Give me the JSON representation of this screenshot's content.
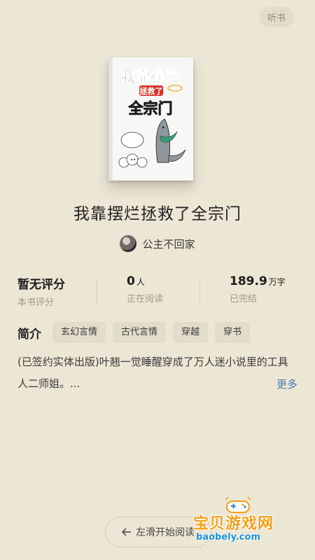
{
  "header": {
    "listen_label": "听书"
  },
  "book": {
    "cover_lines": [
      "我靠摆烂",
      "拯救了",
      "全宗门"
    ],
    "title": "我靠摆烂拯救了全宗门",
    "author": "公主不回家"
  },
  "stats": [
    {
      "value": "暂无评分",
      "unit": "",
      "caption": "本书评分"
    },
    {
      "value": "0",
      "unit": "人",
      "caption": "正在阅读"
    },
    {
      "value": "189.9",
      "unit": "万字",
      "caption": "已完结"
    }
  ],
  "intro": {
    "label": "简介",
    "tags": [
      "玄幻言情",
      "古代言情",
      "穿越",
      "穿书"
    ],
    "synopsis": "(已签约实体出版)叶翘一觉睡醒穿成了万人迷小说里的工具人二师姐。...",
    "more_label": "更多"
  },
  "footer": {
    "swipe_label": "左滑开始阅读",
    "swipe_icon": "arrow-left-icon"
  },
  "watermark": {
    "title": "宝贝游戏网",
    "url": "baobely.com"
  },
  "colors": {
    "background": "#ece6d4",
    "link": "#4a7ab8",
    "watermark_orange": "#f2a11a",
    "watermark_blue": "#1c8fd8"
  }
}
